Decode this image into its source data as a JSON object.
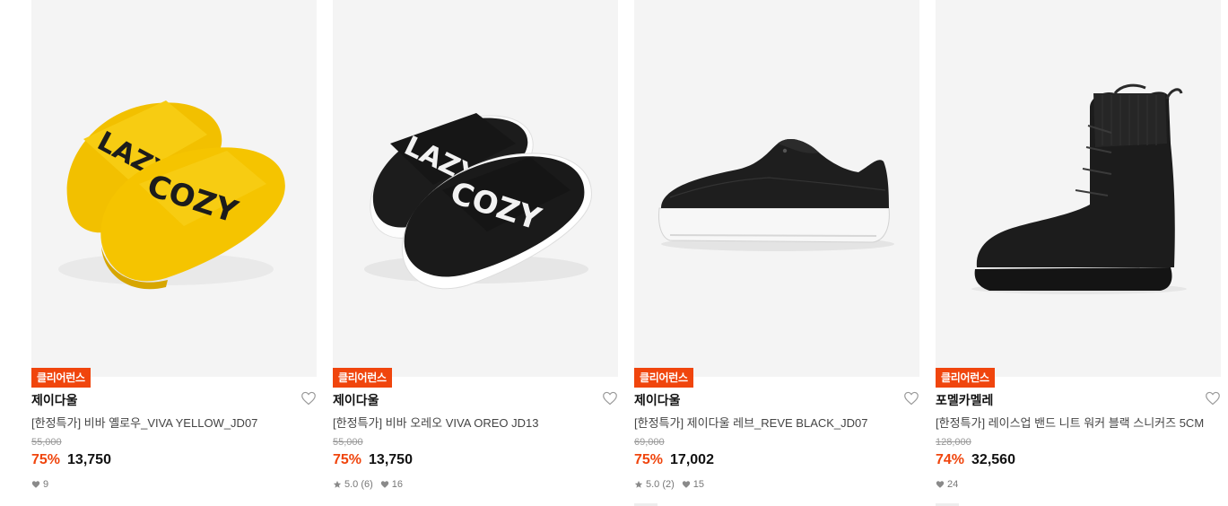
{
  "products": [
    {
      "badge": "클리어런스",
      "brand": "제이다울",
      "title": "[한정특가] 비바 옐로우_VIVA YELLOW_JD07",
      "original_price": "55,000",
      "discount": "75%",
      "sale_price": "13,750",
      "rating": "",
      "likes": "9",
      "image": "yellow-slide-sandals"
    },
    {
      "badge": "클리어런스",
      "brand": "제이다울",
      "title": "[한정특가] 비바 오레오 VIVA OREO JD13",
      "original_price": "55,000",
      "discount": "75%",
      "sale_price": "13,750",
      "rating": "5.0 (6)",
      "likes": "16",
      "image": "black-slide-sandals"
    },
    {
      "badge": "클리어런스",
      "brand": "제이다울",
      "title": "[한정특가] 제이다울 레브_REVE BLACK_JD07",
      "original_price": "69,000",
      "discount": "75%",
      "sale_price": "17,002",
      "rating": "5.0 (2)",
      "likes": "15",
      "image": "black-slip-on-sneaker"
    },
    {
      "badge": "클리어런스",
      "brand": "포멜카멜레",
      "title": "[한정특가] 레이스업 밴드 니트 워커 블랙 스니커즈 5CM",
      "original_price": "128,000",
      "discount": "74%",
      "sale_price": "32,560",
      "rating": "",
      "likes": "24",
      "image": "black-knit-walker-boot"
    }
  ],
  "colors": {
    "accent": "#f0450d",
    "image_bg": "#f4f4f4",
    "yellow": "#f5c400"
  },
  "icons": {
    "wishlist": "heart-outline-icon",
    "rating": "star-icon",
    "likes": "heart-filled-icon"
  }
}
